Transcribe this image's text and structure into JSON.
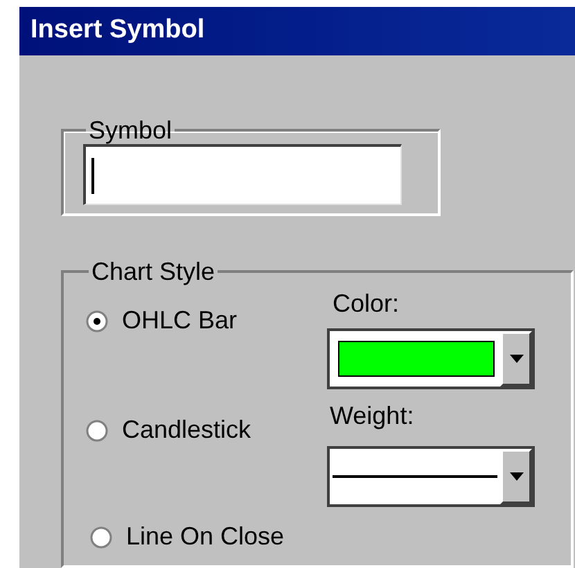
{
  "window": {
    "title": "Insert Symbol"
  },
  "symbol_group": {
    "label": "Symbol"
  },
  "chart_style": {
    "label": "Chart Style",
    "options": [
      {
        "label": "OHLC Bar",
        "selected": true
      },
      {
        "label": "Candlestick",
        "selected": false
      },
      {
        "label": "Line On Close",
        "selected": false
      }
    ],
    "color": {
      "label": "Color:",
      "color": "#00ff00"
    },
    "weight": {
      "label": "Weight:"
    }
  }
}
